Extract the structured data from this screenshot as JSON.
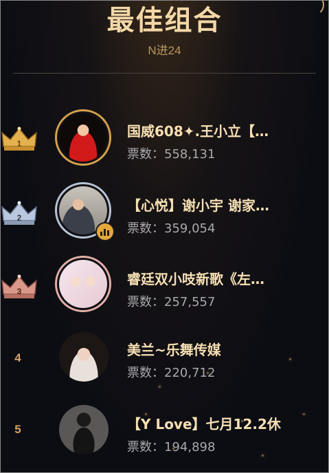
{
  "header": {
    "title": "最佳组合",
    "subtitle": "N进24"
  },
  "colors": {
    "accent_gold": "#d4a24e",
    "name_text": "#f6dfb3",
    "votes_text": "#a9a9ad",
    "rank_number": "#d6a16a"
  },
  "ranking": [
    {
      "rank": "1",
      "badge": "gold-crown-icon",
      "name": "国威608✦.王小立【…",
      "votes_label": "票数：558,131"
    },
    {
      "rank": "2",
      "badge": "silver-crown-icon",
      "name": "【心悦】谢小宇 谢家…",
      "votes_label": "票数：359,054"
    },
    {
      "rank": "3",
      "badge": "bronze-crown-icon",
      "name": "睿廷双小吱新歌《左…",
      "votes_label": "票数：257,557"
    },
    {
      "rank": "4",
      "badge": "",
      "name": "美兰~乐舞传媒",
      "votes_label": "票数：220,712"
    },
    {
      "rank": "5",
      "badge": "",
      "name": "【Y Love】七月12.2休",
      "votes_label": "票数：194,898"
    }
  ]
}
